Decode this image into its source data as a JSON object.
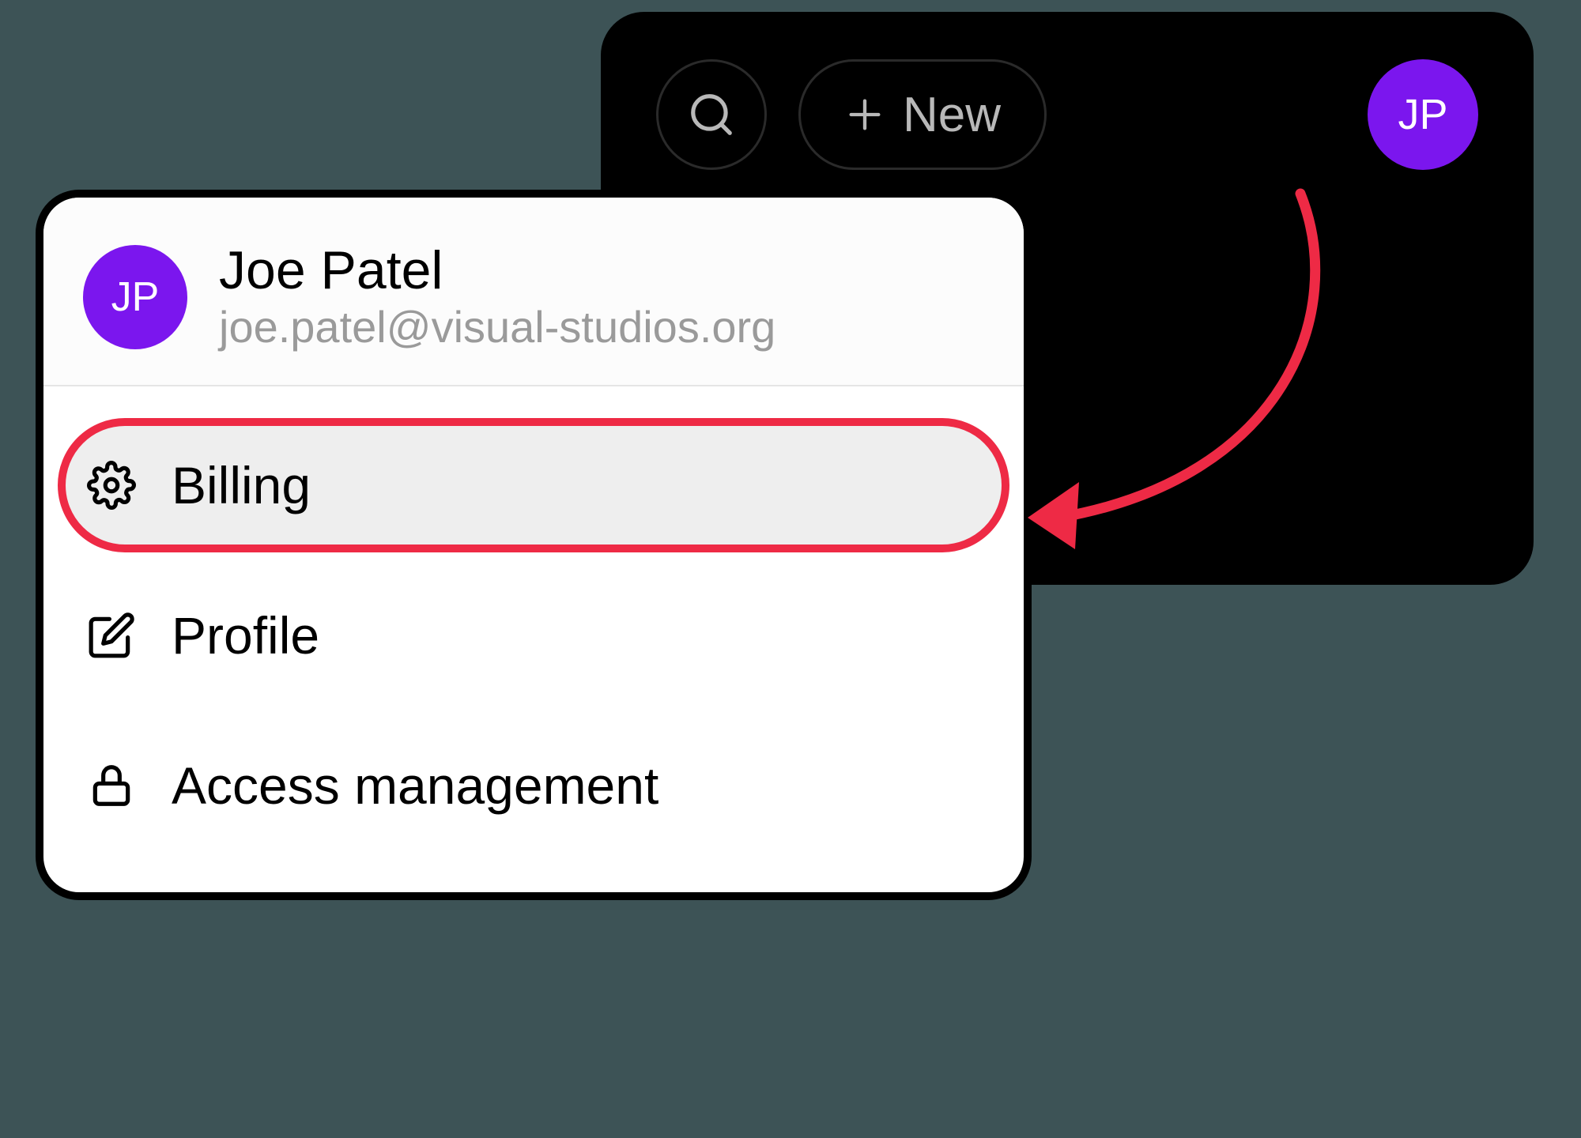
{
  "toolbar": {
    "new_button_label": "New",
    "avatar_initials": "JP"
  },
  "user": {
    "initials": "JP",
    "name": "Joe Patel",
    "email": "joe.patel@visual-studios.org"
  },
  "menu": {
    "items": [
      {
        "icon": "gear",
        "label": "Billing",
        "highlighted": true
      },
      {
        "icon": "edit",
        "label": "Profile",
        "highlighted": false
      },
      {
        "icon": "lock",
        "label": "Access management",
        "highlighted": false
      }
    ]
  },
  "annotation": {
    "highlight_color": "#ee2a45",
    "avatar_color": "#7b16ee"
  }
}
